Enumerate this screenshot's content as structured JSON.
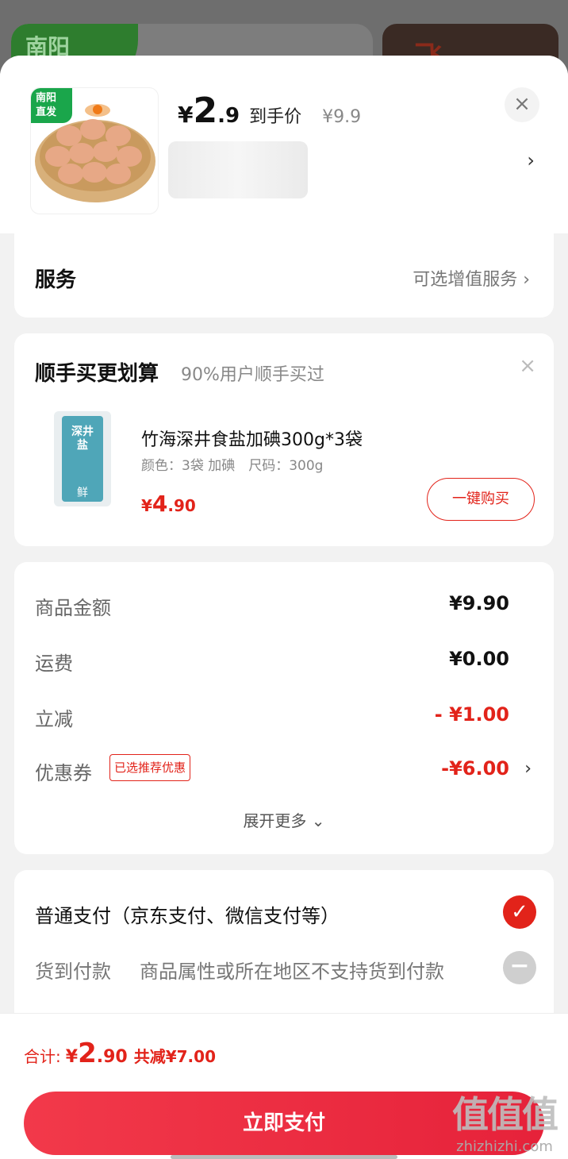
{
  "background": {
    "card1_tag": "南阳",
    "card2_glyph": "飞"
  },
  "product": {
    "badge": "南阳\n直发",
    "currency": "¥",
    "price_int": "2",
    "price_dec": ".9",
    "price_label": "到手价",
    "original_price": "¥9.9",
    "close_icon": "×",
    "chevron": "›"
  },
  "service": {
    "title": "服务",
    "right_label": "可选增值服务 ›"
  },
  "addon": {
    "title": "顺手买更划算",
    "subtitle": "90%用户顺手买过",
    "close_icon": "×",
    "image_text": "深井盐",
    "image_text2": "鲜",
    "product_name": "竹海深井食盐加碘300g*3袋",
    "product_spec": "颜色：3袋 加碘　尺码：300g",
    "price_currency": "¥",
    "price_int": "4",
    "price_dec": ".90",
    "buy_button": "一键购买"
  },
  "amounts": {
    "rows": [
      {
        "key": "商品金额",
        "value": "¥9.90"
      },
      {
        "key": "运费",
        "value": "¥0.00"
      },
      {
        "key": "立减",
        "value": "- ¥1.00"
      },
      {
        "key": "优惠券",
        "value": "-¥6.00",
        "tag": "已选推荐优惠",
        "chevron": "›"
      }
    ],
    "expand": "展开更多 ⌄"
  },
  "payment": {
    "normal": "普通支付（京东支付、微信支付等）",
    "check_icon": "✓",
    "cod_label": "货到付款",
    "cod_note": "商品属性或所在地区不支持货到付款",
    "disabled_icon": "−"
  },
  "footer": {
    "total_label": "合计:",
    "total_currency": "¥",
    "total_int": "2",
    "total_dec": ".90",
    "total_saved": "共减¥7.00",
    "pay_button": "立即支付"
  },
  "watermark": {
    "big": "值值值",
    "small": "zhizhizhi.com"
  },
  "colors": {
    "accent_red": "#e2231a",
    "badge_green": "#1aa64b"
  }
}
